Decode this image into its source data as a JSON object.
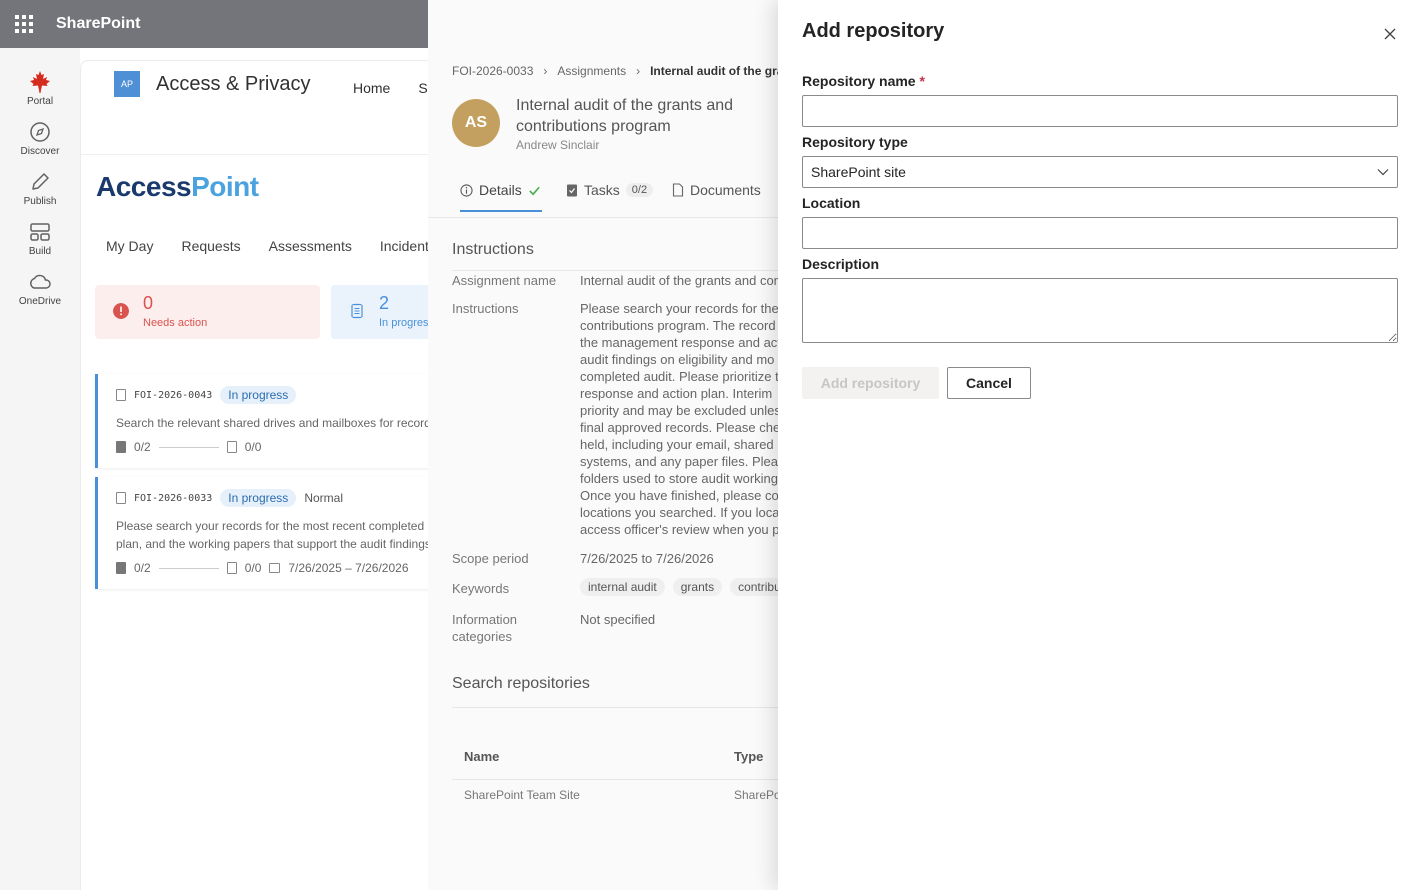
{
  "suitebar": {
    "title": "SharePoint"
  },
  "rail": {
    "items": [
      {
        "label": "Portal"
      },
      {
        "label": "Discover"
      },
      {
        "label": "Publish"
      },
      {
        "label": "Build"
      },
      {
        "label": "OneDrive"
      }
    ]
  },
  "site": {
    "logo_text": "AP",
    "title": "Access & Privacy",
    "nav": [
      "Home",
      "Si"
    ],
    "brand_part1": "Access",
    "brand_part2": "Point",
    "tabs": [
      "My Day",
      "Requests",
      "Assessments",
      "Incidents"
    ],
    "stats": [
      {
        "value": "0",
        "label": "Needs action"
      },
      {
        "value": "2",
        "label": "In progress"
      }
    ],
    "requests": [
      {
        "id": "FOI-2026-0043",
        "status": "In progress",
        "description": "Search the relevant shared drives and mailboxes for records related to the request",
        "tasks": "0/2",
        "documents": "0/0"
      },
      {
        "id": "FOI-2026-0033",
        "status": "In progress",
        "priority": "Normal",
        "description_line1": "Please search your records for the most recent completed audit",
        "description_line2": "plan, and the working papers that support the audit findings",
        "tasks": "0/2",
        "documents": "0/0",
        "dates": "7/26/2025 – 7/26/2026"
      }
    ]
  },
  "detail": {
    "breadcrumb": [
      "FOI-2026-0033",
      "Assignments",
      "Internal audit of the grants"
    ],
    "avatar_initials": "AS",
    "title": "Internal audit of the grants and contributions program",
    "assignee": "Andrew Sinclair",
    "tabs": {
      "details": "Details",
      "tasks": "Tasks",
      "tasks_count": "0/2",
      "documents": "Documents"
    },
    "section_instructions": "Instructions",
    "assignment_name_label": "Assignment name",
    "assignment_name_value": "Internal audit of the grants and contributions program",
    "instructions_label": "Instructions",
    "instructions_lines": [
      "Please search your records for the",
      "contributions program. The record",
      "the management response and act",
      "audit findings on eligibility and mo",
      "completed audit. Please prioritize t",
      "response and action plan. Interim",
      "priority and may be excluded unles",
      "final approved records. Please chec",
      "held, including your email, shared",
      "systems, and any paper files. Pleas",
      "folders used to store audit working",
      "Once you have finished, please co",
      "locations you searched. If you loca",
      "access officer's review when you p"
    ],
    "scope_label": "Scope period",
    "scope_value": "7/26/2025 to 7/26/2026",
    "keywords_label": "Keywords",
    "keywords": [
      "internal audit",
      "grants",
      "contributions"
    ],
    "info_cat_label_1": "Information",
    "info_cat_label_2": "categories",
    "info_cat_value": "Not specified",
    "section_repos": "Search repositories",
    "table_headers": [
      "Name",
      "Type"
    ],
    "table_rows": [
      {
        "name": "SharePoint Team Site",
        "type": "SharePoint"
      }
    ]
  },
  "dialog": {
    "title": "Add repository",
    "name_label": "Repository name",
    "required_mark": "*",
    "name_value": "",
    "type_label": "Repository type",
    "type_value": "SharePoint site",
    "location_label": "Location",
    "location_value": "",
    "description_label": "Description",
    "description_value": "",
    "add_button": "Add repository",
    "cancel_button": "Cancel"
  },
  "colors": {
    "suitebar": "#74757a",
    "brand_dark": "#1a3a6e",
    "brand_light": "#4aa3df",
    "accent": "#4a90d9",
    "required": "#c4314b",
    "avatar": "#c4a060"
  }
}
